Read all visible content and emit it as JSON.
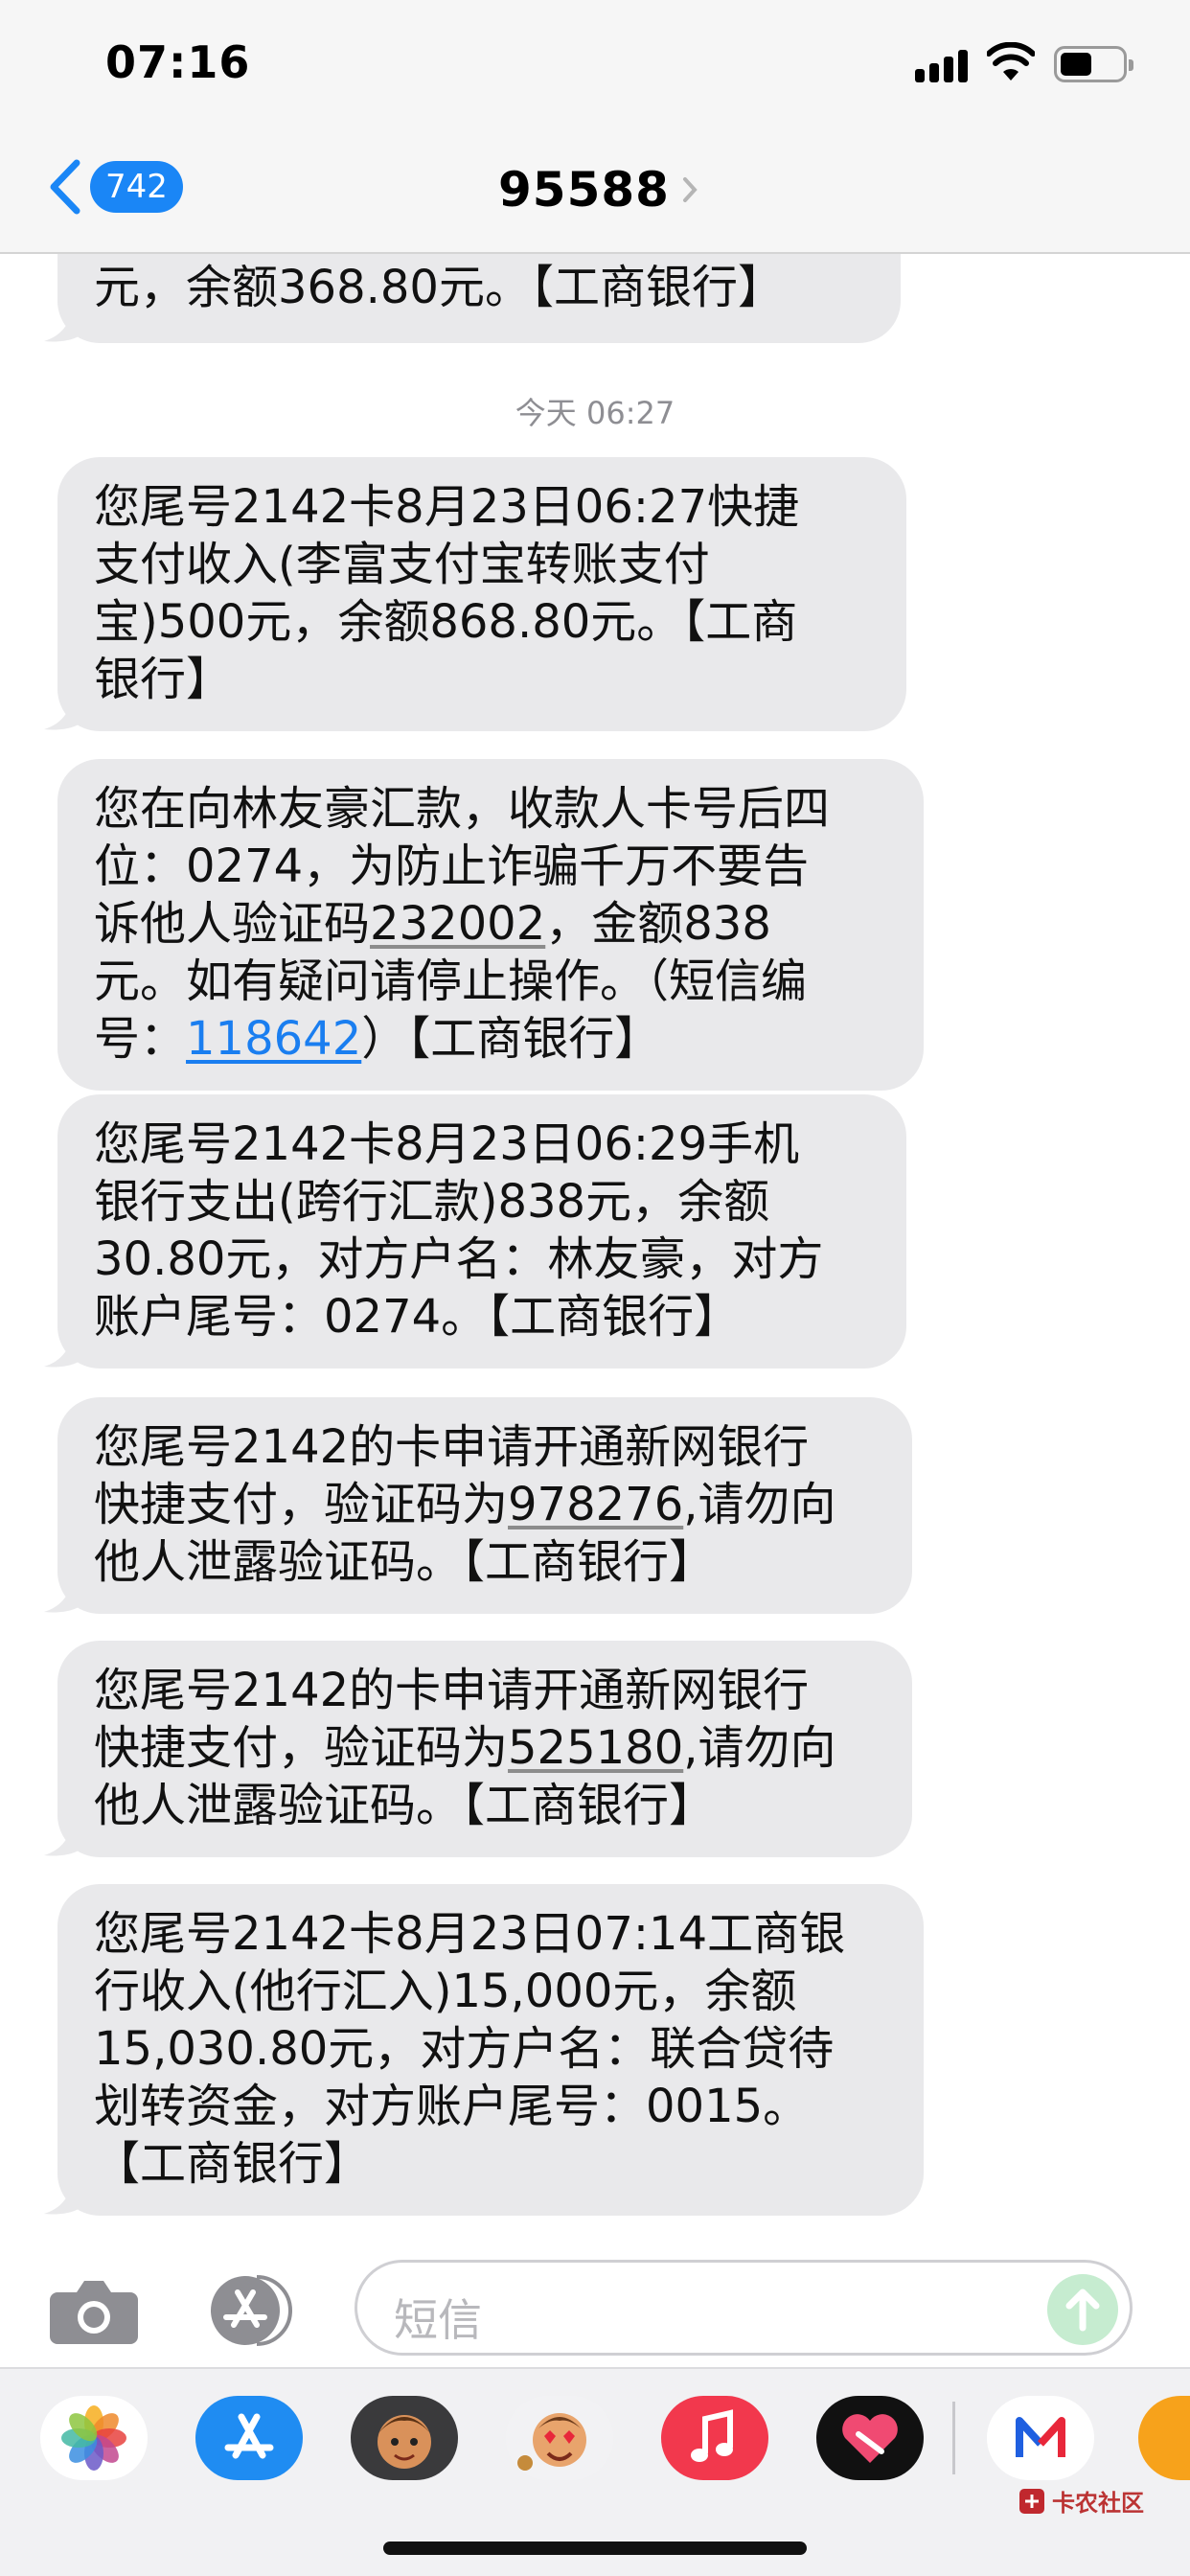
{
  "status_bar": {
    "time": "07:16"
  },
  "nav": {
    "back_badge": "742",
    "contact": "95588"
  },
  "timestamp": "今天 06:27",
  "messages": [
    {
      "lines": [
        "元，余额368.80元。【工商银行】"
      ]
    },
    {
      "lines": [
        "您尾号2142卡8月23日06:27快捷",
        "支付收入(李富支付宝转账支付",
        "宝)500元，余额868.80元。【工商",
        "银行】"
      ]
    },
    {
      "lines": [
        "您在向林友豪汇款，收款人卡号后四",
        "位：0274，为防止诈骗千万不要告",
        "诉他人验证码",
        "232002",
        "，金额838",
        "元。如有疑问请停止操作。（短信编",
        "号：",
        "118642",
        "）【工商银行】"
      ]
    },
    {
      "lines": [
        "您尾号2142卡8月23日06:29手机",
        "银行支出(跨行汇款)838元，余额",
        "30.80元，对方户名：林友豪，对方",
        "账户尾号：0274。【工商银行】"
      ]
    },
    {
      "lines": [
        "您尾号2142的卡申请开通新网银行",
        "快捷支付，验证码为",
        "978276",
        ",请勿向",
        "他人泄露验证码。【工商银行】"
      ]
    },
    {
      "lines": [
        "您尾号2142的卡申请开通新网银行",
        "快捷支付，验证码为",
        "525180",
        ",请勿向",
        "他人泄露验证码。【工商银行】"
      ]
    },
    {
      "lines": [
        "您尾号2142卡8月23日07:14工商银",
        "行收入(他行汇入)15,000元，余额",
        "15,030.80元，对方户名：联合贷待",
        "划转资金，对方账户尾号：0015。",
        "【工商银行】"
      ]
    }
  ],
  "input": {
    "placeholder": "短信"
  },
  "watermark": "卡农社区",
  "icons": [
    "signal-icon",
    "wifi-icon",
    "battery-icon",
    "back-chevron-icon",
    "camera-icon",
    "app-store-icon",
    "send-arrow-icon",
    "photos-icon",
    "memoji-icon",
    "music-icon",
    "heart-app-icon",
    "m-app-icon"
  ]
}
